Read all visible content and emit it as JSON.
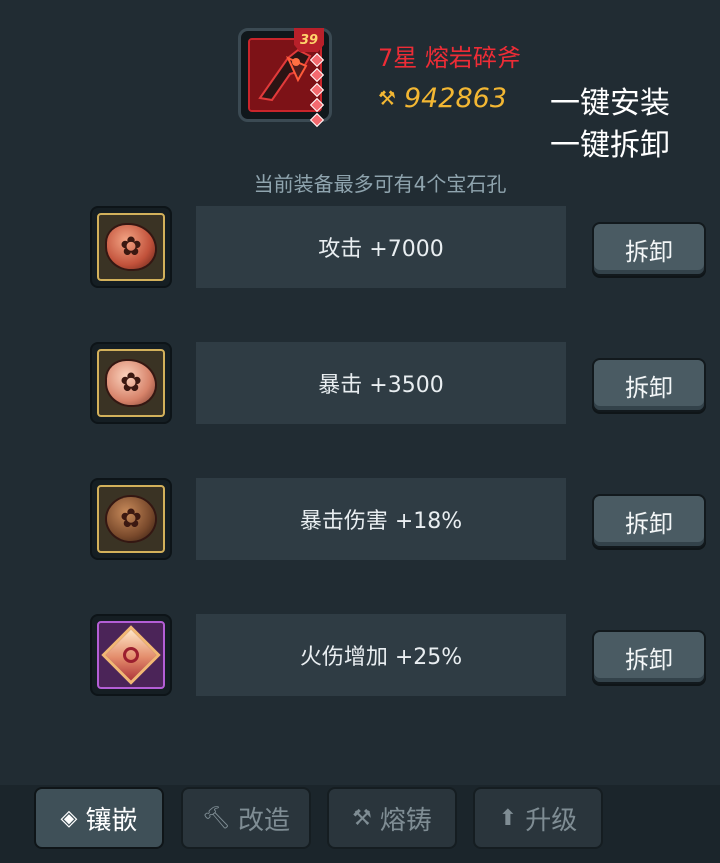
{
  "item": {
    "level": "39",
    "name": "7星 熔岩碎斧",
    "power": "942863",
    "power_icon": "power-icon"
  },
  "quick_actions": {
    "install_all": "一键安装",
    "remove_all": "一键拆卸"
  },
  "hint": "当前装备最多可有4个宝石孔",
  "gems": [
    {
      "stat": "攻击 +7000",
      "button": "拆卸",
      "icon": "attack-gem-icon"
    },
    {
      "stat": "暴击 +3500",
      "button": "拆卸",
      "icon": "crit-gem-icon"
    },
    {
      "stat": "暴击伤害 +18%",
      "button": "拆卸",
      "icon": "crit-damage-gem-icon"
    },
    {
      "stat": "火伤增加 +25%",
      "button": "拆卸",
      "icon": "fire-damage-gem-icon"
    }
  ],
  "tabs": [
    {
      "label": "镶嵌",
      "icon": "gem-inlay-icon",
      "active": true
    },
    {
      "label": "改造",
      "icon": "hammer-icon",
      "active": false
    },
    {
      "label": "熔铸",
      "icon": "forge-icon",
      "active": false
    },
    {
      "label": "升级",
      "icon": "upgrade-arrow-icon",
      "active": false
    }
  ],
  "colors": {
    "background": "#212c33",
    "item_name": "#ee2c36",
    "power": "#f3b733",
    "stat_box": "#2f3c44",
    "button": "#4a5b63"
  }
}
